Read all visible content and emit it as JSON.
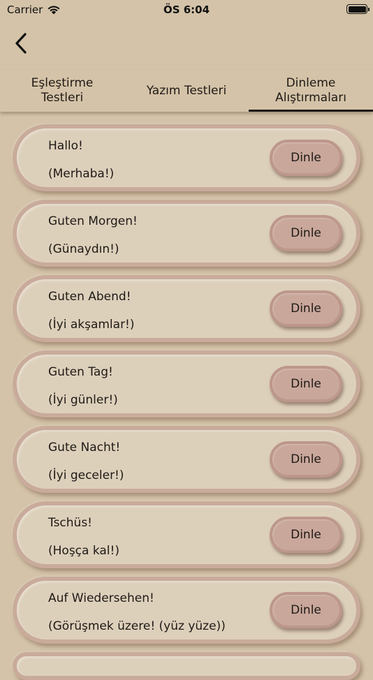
{
  "status_bar": {
    "carrier": "Carrier",
    "time": "ÖS 6:04"
  },
  "tabs": [
    {
      "label": "Eşleştirme\nTestleri",
      "active": false
    },
    {
      "label": "Yazım Testleri",
      "active": false
    },
    {
      "label": "Dinleme\nAlıştırmaları",
      "active": true
    }
  ],
  "listen_label": "Dinle",
  "phrases": [
    {
      "word": "Hallo!",
      "meaning": "(Merhaba!)"
    },
    {
      "word": "Guten Morgen!",
      "meaning": "(Günaydın!)"
    },
    {
      "word": "Guten Abend!",
      "meaning": "(İyi akşamlar!)"
    },
    {
      "word": "Guten Tag!",
      "meaning": "(İyi günler!)"
    },
    {
      "word": "Gute Nacht!",
      "meaning": "(İyi geceler!)"
    },
    {
      "word": "Tschüs!",
      "meaning": "(Hoşça kal!)"
    },
    {
      "word": "Auf Wiedersehen!",
      "meaning": "(Görüşmek üzere! (yüz yüze))"
    }
  ],
  "colors": {
    "background": "#d4c3a8",
    "card": "#ddd0bb",
    "card_border": "#c9ab9b",
    "button": "#c9a79b"
  }
}
